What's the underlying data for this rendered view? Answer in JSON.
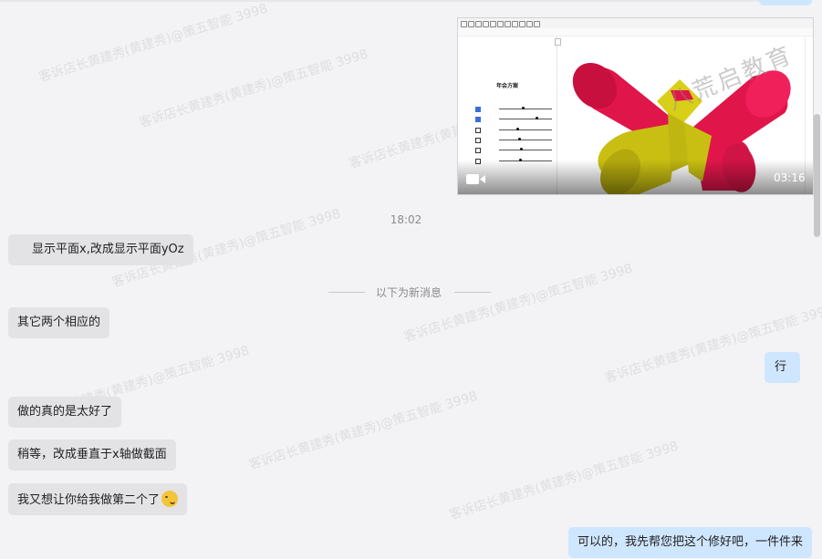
{
  "video": {
    "duration": "03:16",
    "panel_title": "年会方案",
    "watermark_brand": "八荒启教育",
    "sliders": [
      {
        "checked": true,
        "value": 0.45
      },
      {
        "checked": true,
        "value": 0.7
      },
      {
        "checked": false,
        "value": 0.35
      },
      {
        "checked": false,
        "value": 0.38
      },
      {
        "checked": false,
        "value": 0.42
      },
      {
        "checked": false,
        "value": 0.4
      }
    ]
  },
  "time_separator": "18:02",
  "new_messages_label": "以下为新消息",
  "messages": [
    {
      "side": "in",
      "text": "显示平面x,改成显示平面yOz"
    },
    {
      "side": "in",
      "text": "其它两个相应的"
    },
    {
      "side": "out",
      "text": "行"
    },
    {
      "side": "in",
      "text": "做的真的是太好了"
    },
    {
      "side": "in",
      "text": "稍等，改成垂直于x轴做截面"
    },
    {
      "side": "in",
      "text": "我又想让你给我做第二个了"
    },
    {
      "side": "out",
      "text": "可以的，我先帮您把这个修好吧，一件件来"
    }
  ],
  "watermark_text": "客诉店长黄建秀(黄建秀)@策五智能 3998",
  "colors": {
    "incoming": "#e3e3e6",
    "outgoing": "#cfe6ff",
    "red": "#e0164a",
    "yellow": "#c9bf12"
  }
}
